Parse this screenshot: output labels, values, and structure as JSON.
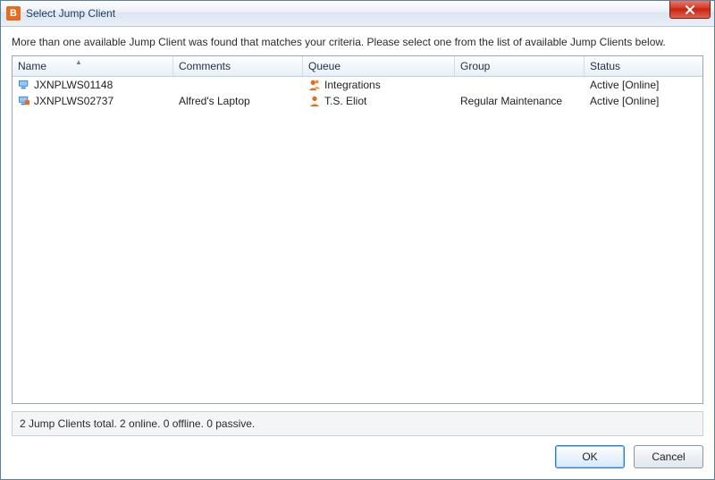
{
  "title": "Select Jump Client",
  "instruction": "More than one available Jump Client was found that matches your criteria. Please select one from the list of available Jump Clients below.",
  "columns": {
    "name": "Name",
    "comments": "Comments",
    "queue": "Queue",
    "group": "Group",
    "status": "Status"
  },
  "rows": [
    {
      "name": "JXNPLWS01148",
      "comments": "",
      "queue": "Integrations",
      "group": "",
      "status": "Active [Online]",
      "icon": "pc-blue",
      "queueIcon": "people"
    },
    {
      "name": "JXNPLWS02737",
      "comments": "Alfred's Laptop",
      "queue": "T.S. Eliot",
      "group": "Regular Maintenance",
      "status": "Active [Online]",
      "icon": "pc-blue-flag",
      "queueIcon": "person"
    }
  ],
  "statusBar": "2 Jump Clients total.  2 online.  0 offline.  0 passive.",
  "buttons": {
    "ok": "OK",
    "cancel": "Cancel"
  }
}
